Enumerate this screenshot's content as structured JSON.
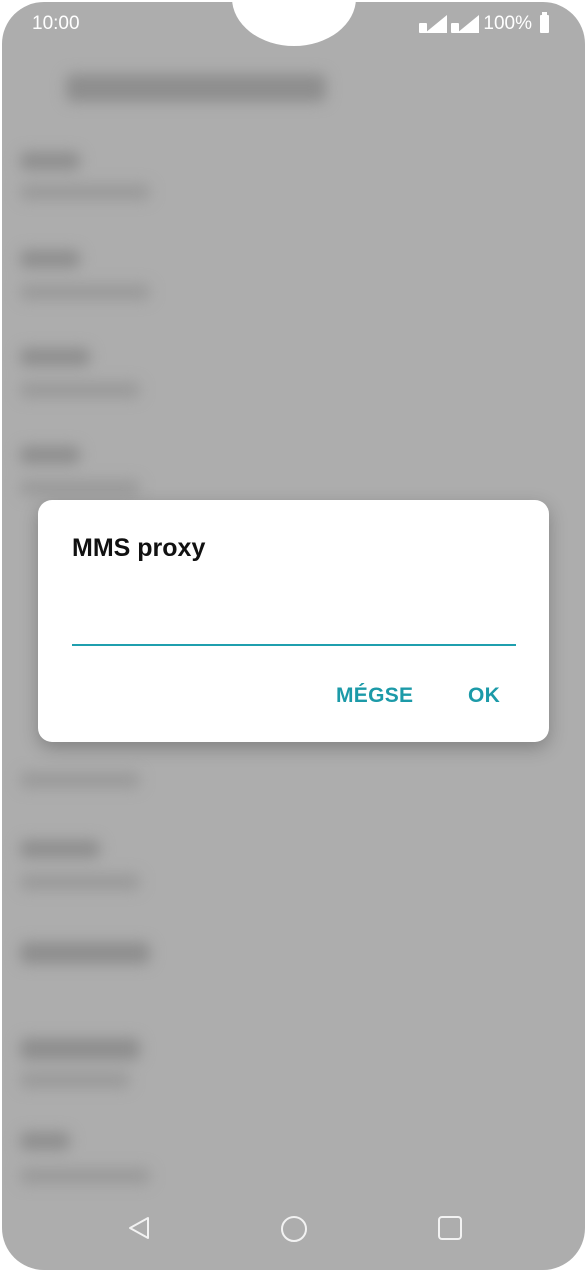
{
  "status_bar": {
    "time": "10:00",
    "battery_percent": "100%"
  },
  "dialog": {
    "title": "MMS proxy",
    "input_value": "",
    "input_placeholder": "",
    "cancel_label": "MÉGSE",
    "ok_label": "OK"
  },
  "icons": {
    "signal_1": "signal-icon",
    "signal_2": "signal-icon",
    "battery": "battery-icon",
    "back": "back-icon",
    "home": "home-icon",
    "recents": "recents-icon"
  },
  "colors": {
    "accent": "#1c9aa8",
    "scrim": "#adadad",
    "dialog_bg": "#ffffff"
  }
}
